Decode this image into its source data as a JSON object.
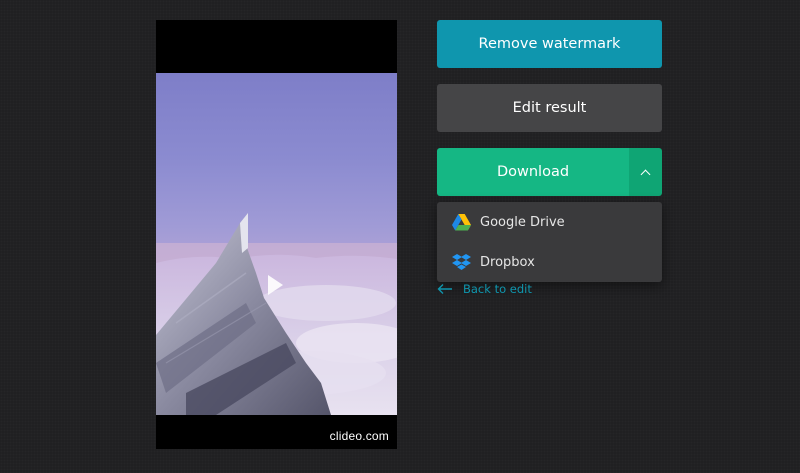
{
  "player": {
    "watermark": "clideo.com",
    "icons": {
      "play": "play-icon"
    }
  },
  "actions": {
    "remove_watermark_label": "Remove watermark",
    "edit_result_label": "Edit result",
    "download_label": "Download",
    "toggle_icon": "chevron-up-icon"
  },
  "download_menu": {
    "items": [
      {
        "label": "Google Drive",
        "icon": "google-drive-icon"
      },
      {
        "label": "Dropbox",
        "icon": "dropbox-icon"
      }
    ]
  },
  "back_link": {
    "label": "Back to edit",
    "icon": "arrow-left-icon"
  },
  "colors": {
    "background": "#202022",
    "remove_watermark": "#0f96ae",
    "edit_result": "#454547",
    "download": "#15b784",
    "download_toggle": "#0fa574",
    "dropdown": "#3a3a3c",
    "link": "#0f96ae"
  }
}
